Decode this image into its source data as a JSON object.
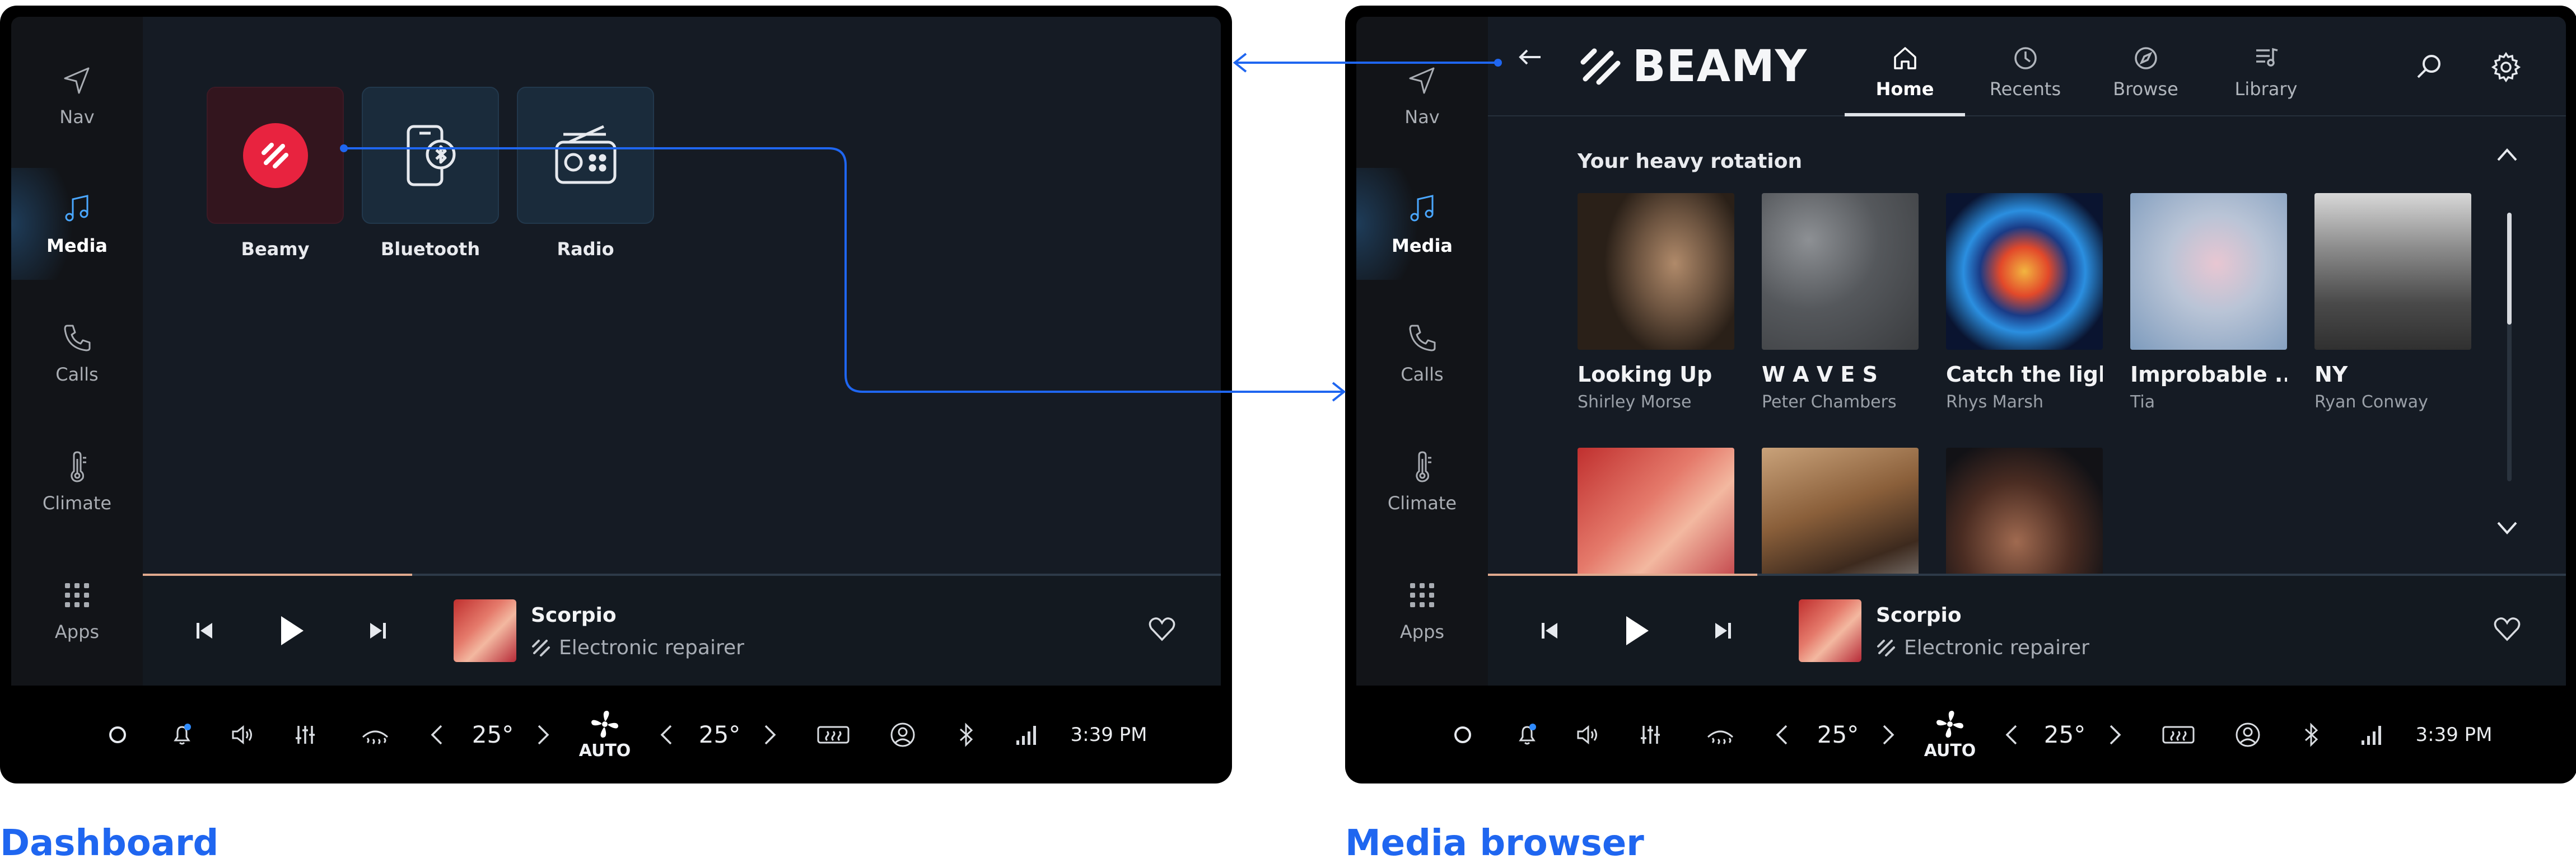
{
  "sidebar": {
    "items": [
      {
        "label": "Nav",
        "icon": "navigation-arrow-icon"
      },
      {
        "label": "Media",
        "icon": "music-note-icon"
      },
      {
        "label": "Calls",
        "icon": "phone-icon"
      },
      {
        "label": "Climate",
        "icon": "thermometer-icon"
      },
      {
        "label": "Apps",
        "icon": "grid-icon"
      }
    ],
    "active": "Media"
  },
  "dashboard": {
    "caption": "Dashboard",
    "apps": [
      {
        "label": "Beamy",
        "icon": "beamy-logo-icon"
      },
      {
        "label": "Bluetooth",
        "icon": "phone-bluetooth-icon"
      },
      {
        "label": "Radio",
        "icon": "radio-icon"
      }
    ]
  },
  "media_browser": {
    "caption": "Media browser",
    "brand": "BEAMY",
    "tabs": [
      {
        "label": "Home",
        "icon": "home-icon"
      },
      {
        "label": "Recents",
        "icon": "clock-icon"
      },
      {
        "label": "Browse",
        "icon": "compass-icon"
      },
      {
        "label": "Library",
        "icon": "library-icon"
      }
    ],
    "active_tab": "Home",
    "section_title": "Your heavy rotation",
    "albums": [
      {
        "title": "Looking Up",
        "artist": "Shirley Morse"
      },
      {
        "title": "W A V E S",
        "artist": "Peter Chambers"
      },
      {
        "title": "Catch the light",
        "artist": "Rhys Marsh"
      },
      {
        "title": "Improbable ...",
        "artist": "Tia"
      },
      {
        "title": "NY",
        "artist": "Ryan Conway"
      }
    ],
    "albums_row2_count_visible": 3
  },
  "now_playing": {
    "title": "Scorpio",
    "artist": "Electronic repairer",
    "progress_fraction": 0.25
  },
  "statusbar": {
    "temp_left": "25°",
    "temp_right": "25°",
    "fan_mode": "AUTO",
    "time": "3:39 PM"
  },
  "colors": {
    "accent": "#1f66f0",
    "brand_red": "#e8233f",
    "progress": "#e0a98e"
  }
}
